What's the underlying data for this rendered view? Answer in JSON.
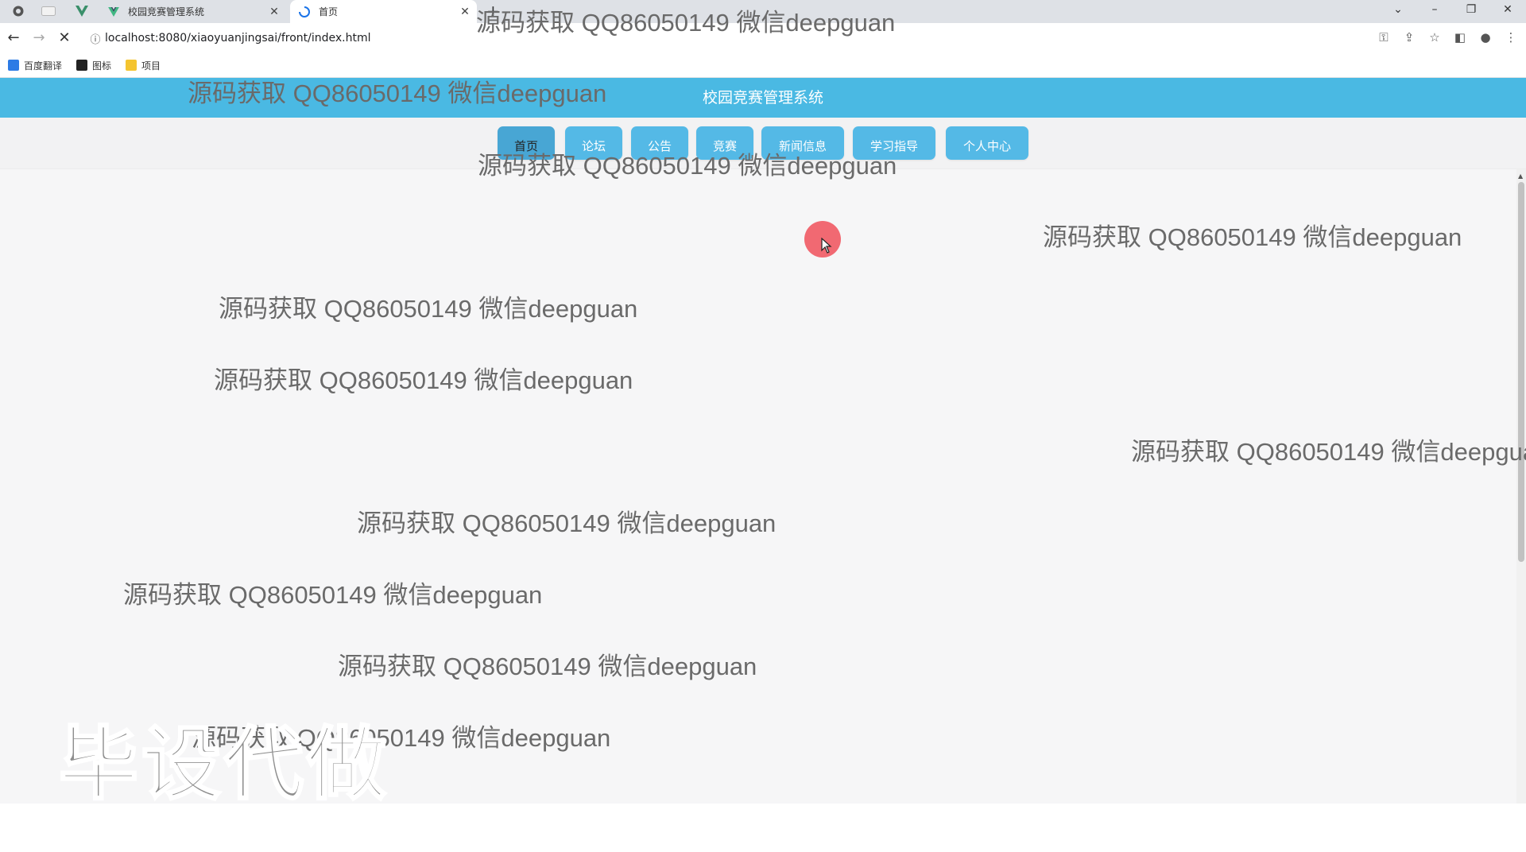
{
  "browser": {
    "tabs": [
      {
        "title": "校园竞赛管理系统",
        "active": false
      },
      {
        "title": "首页",
        "active": true
      }
    ],
    "new_tab": "+",
    "url": "localhost:8080/xiaoyuanjingsai/front/index.html",
    "bookmarks": [
      {
        "label": "百度翻译",
        "icon": "translate-icon",
        "color": "#2d7be5"
      },
      {
        "label": "图标",
        "icon": "icon-library-icon",
        "color": "#222222"
      },
      {
        "label": "项目",
        "icon": "folder-icon",
        "color": "#f4c430"
      }
    ]
  },
  "site": {
    "title": "校园竞赛管理系统",
    "nav": [
      {
        "label": "首页",
        "active": true
      },
      {
        "label": "论坛",
        "active": false
      },
      {
        "label": "公告",
        "active": false
      },
      {
        "label": "竞赛",
        "active": false
      },
      {
        "label": "新闻信息",
        "active": false
      },
      {
        "label": "学习指导",
        "active": false
      },
      {
        "label": "个人中心",
        "active": false
      }
    ]
  },
  "watermarks": {
    "text": "源码获取 QQ86050149 微信deepguan",
    "big_text": "毕设代做"
  },
  "colors": {
    "header": "#4ab9e3",
    "nav_button": "#54b9e6",
    "cursor_highlight": "#f0505a"
  }
}
